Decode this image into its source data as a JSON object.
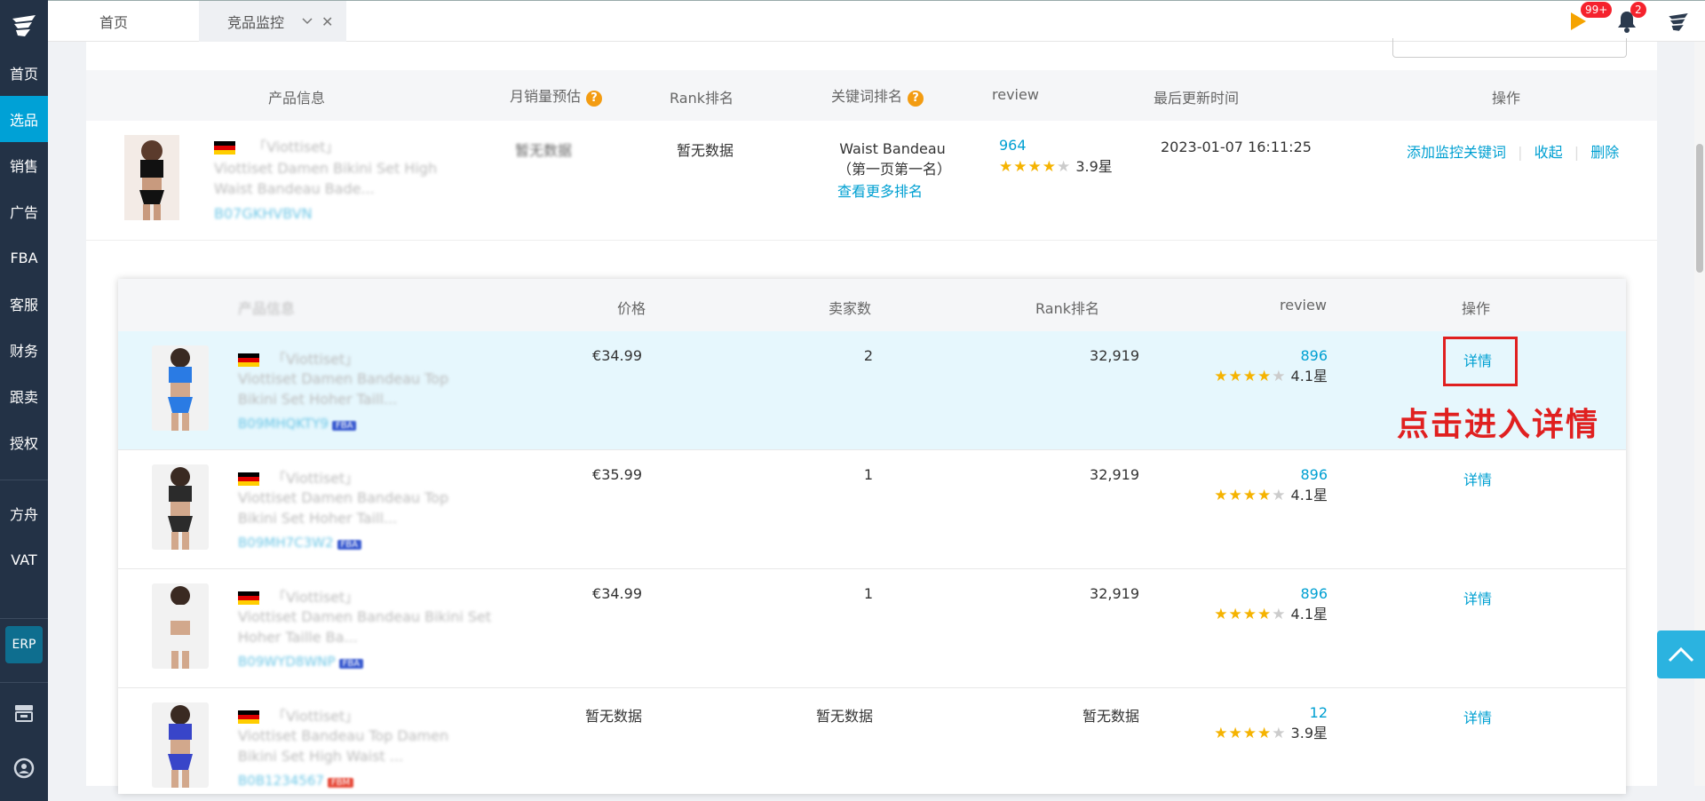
{
  "sidebar": {
    "items": [
      {
        "label": "首页",
        "active": false
      },
      {
        "label": "选品",
        "active": true
      },
      {
        "label": "销售",
        "active": false
      },
      {
        "label": "广告",
        "active": false
      },
      {
        "label": "FBA",
        "active": false
      },
      {
        "label": "客服",
        "active": false
      },
      {
        "label": "财务",
        "active": false
      },
      {
        "label": "跟卖",
        "active": false
      },
      {
        "label": "授权",
        "active": false
      }
    ],
    "items2": [
      {
        "label": "方舟"
      },
      {
        "label": "VAT"
      }
    ],
    "erp_label": "ERP"
  },
  "topbar": {
    "home_tab": "首页",
    "active_tab": "竞品监控",
    "flag_badge": "99+",
    "bell_badge": "2"
  },
  "monitor_table": {
    "headers": [
      "产品信息",
      "月销量预估",
      "Rank排名",
      "关键词排名",
      "review",
      "最后更新时间",
      "操作"
    ],
    "row": {
      "brand": "「Viottiset」",
      "title_line1": "Viottiset Damen Bikini Set High",
      "title_line2": "Waist Bandeau Bade...",
      "asin": "B07GKHVBVN",
      "monthly_sales": "暂无数据",
      "rank": "暂无数据",
      "keyword": "Waist Bandeau",
      "keyword_pos": "（第一页第一名）",
      "keyword_more": "查看更多排名",
      "review_count": "964",
      "rating": 3.9,
      "rating_text": "3.9星",
      "updated": "2023-01-07 16:11:25",
      "action_add": "添加监控关键词",
      "action_collapse": "收起",
      "action_delete": "删除"
    }
  },
  "variant_table": {
    "headers": [
      "产品信息",
      "价格",
      "卖家数",
      "Rank排名",
      "review",
      "操作"
    ],
    "rows": [
      {
        "brand": "「Viottiset」",
        "title_line1": "Viottiset Damen Bandeau Top",
        "title_line2": "Bikini Set Hoher Taill...",
        "asin": "B09MHQKTY9",
        "tag": "FBA",
        "price": "€34.99",
        "sellers": "2",
        "rank": "32,919",
        "review_count": "896",
        "rating": 4.1,
        "rating_text": "4.1星",
        "action": "详情",
        "color": "#2a7be4"
      },
      {
        "brand": "「Viottiset」",
        "title_line1": "Viottiset Damen Bandeau Top",
        "title_line2": "Bikini Set Hoher Taill...",
        "asin": "B09MH7C3W2",
        "tag": "FBA",
        "price": "€35.99",
        "sellers": "1",
        "rank": "32,919",
        "review_count": "896",
        "rating": 4.1,
        "rating_text": "4.1星",
        "action": "详情",
        "color": "#2b2b2b"
      },
      {
        "brand": "「Viottiset」",
        "title_line1": "Viottiset Damen Bandeau Bikini Set",
        "title_line2": "Hoher Taille Ba...",
        "asin": "B09WYD8WNP",
        "tag": "FBA",
        "price": "€34.99",
        "sellers": "1",
        "rank": "32,919",
        "review_count": "896",
        "rating": 4.1,
        "rating_text": "4.1星",
        "action": "详情",
        "color": "#f2f2f2"
      },
      {
        "brand": "「Viottiset」",
        "title_line1": "Viottiset Bandeau Top Damen",
        "title_line2": "Bikini Set High Waist ...",
        "asin": "B0B1234567",
        "tag": "FBM",
        "price": "暂无数据",
        "sellers": "暂无数据",
        "rank": "暂无数据",
        "review_count": "12",
        "rating": 3.9,
        "rating_text": "3.9星",
        "action": "详情",
        "color": "#3845c9"
      }
    ],
    "annotation": "点击进入详情"
  },
  "colors": {
    "sidebar_bg": "#233246",
    "accent": "#00a1d6",
    "annotation": "#e02020"
  }
}
